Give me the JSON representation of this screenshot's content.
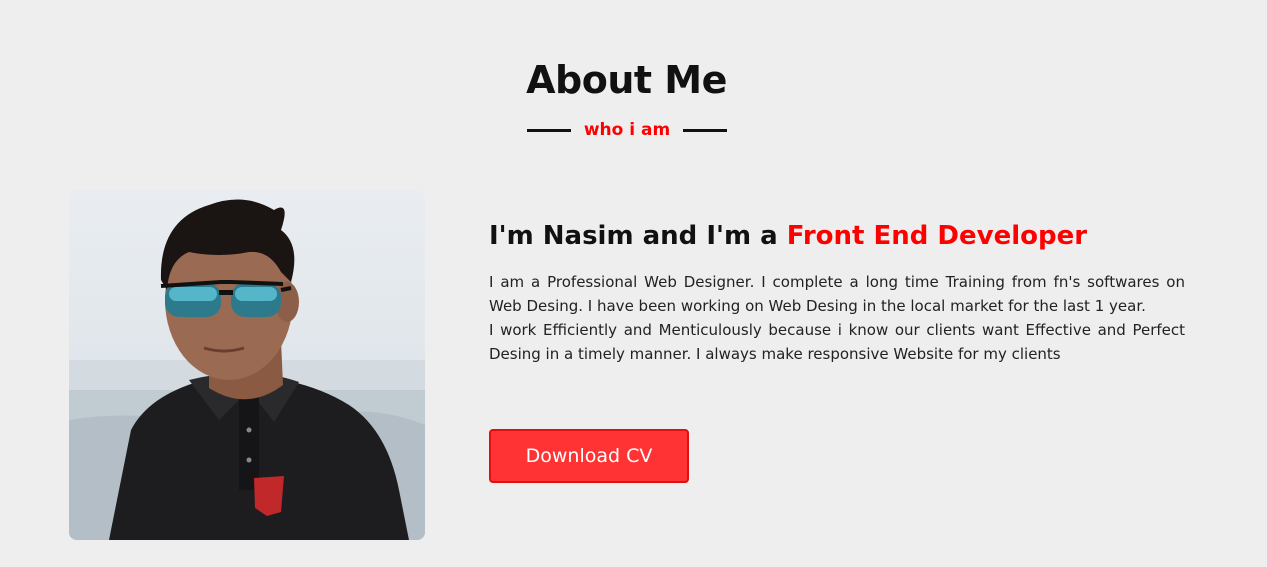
{
  "about": {
    "title": "About Me",
    "subtitle": "who i am",
    "headline_prefix": "I'm Nasim and I'm a ",
    "headline_accent": "Front End Developer",
    "bio_paragraph_1": "I am a Professional Web Designer. I complete a long time Training from fn's softwares on Web Desing. I have been working on Web Desing in the local market for the last 1 year.",
    "bio_paragraph_2": "I work Efficiently and Menticulously because i know our clients want Effective and Perfect Desing in a timely manner. I always make responsive Website for my clients",
    "download_button_label": "Download CV"
  },
  "colors": {
    "background": "#eeeeee",
    "accent": "#ff0000",
    "button": "#ff3333"
  },
  "icons": {
    "photo": "profile-photo"
  }
}
